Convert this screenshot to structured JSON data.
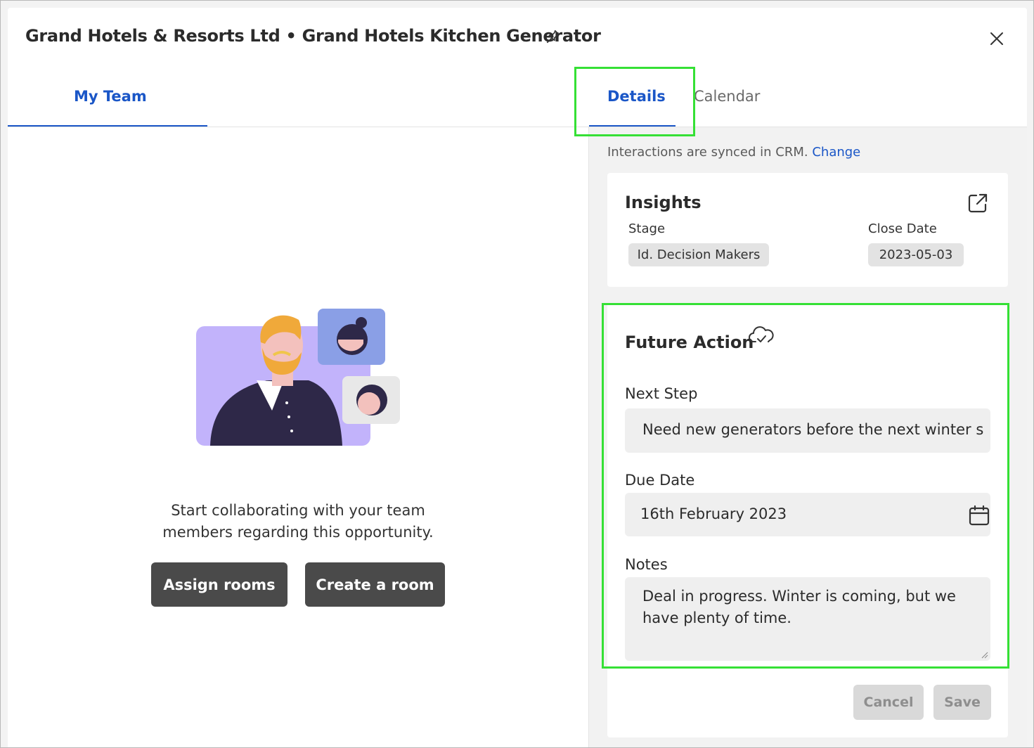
{
  "header": {
    "title": "Grand Hotels & Resorts Ltd • Grand Hotels Kitchen Generator"
  },
  "tabs": {
    "my_team": "My Team",
    "details": "Details",
    "calendar": "Calendar"
  },
  "left_pane": {
    "empty_message_line1": "Start collaborating with your team",
    "empty_message_line2": "members regarding this opportunity.",
    "assign_rooms_label": "Assign rooms",
    "create_room_label": "Create a room"
  },
  "right_pane": {
    "sync_text": "Interactions are synced in CRM.",
    "sync_link": "Change",
    "insights": {
      "title": "Insights",
      "stage_label": "Stage",
      "stage_value": "Id. Decision Makers",
      "close_date_label": "Close Date",
      "close_date_value": "2023-05-03"
    },
    "future_action": {
      "title": "Future Action",
      "next_step_label": "Next Step",
      "next_step_value": "Need new generators before the next winter s",
      "due_date_label": "Due Date",
      "due_date_value": "16th February 2023",
      "notes_label": "Notes",
      "notes_value": "Deal in progress. Winter is coming, but we have plenty of time.",
      "cancel_label": "Cancel",
      "save_label": "Save"
    }
  },
  "colors": {
    "accent": "#1a56c7",
    "highlight": "#35e035",
    "dark_button": "#4a4a4a",
    "panel_bg": "#f2f2f2"
  },
  "icons": {
    "pin": "pin-icon",
    "close": "close-icon",
    "open_external": "open-external-icon",
    "cloud_sync": "cloud-sync-icon",
    "calendar": "calendar-icon"
  }
}
